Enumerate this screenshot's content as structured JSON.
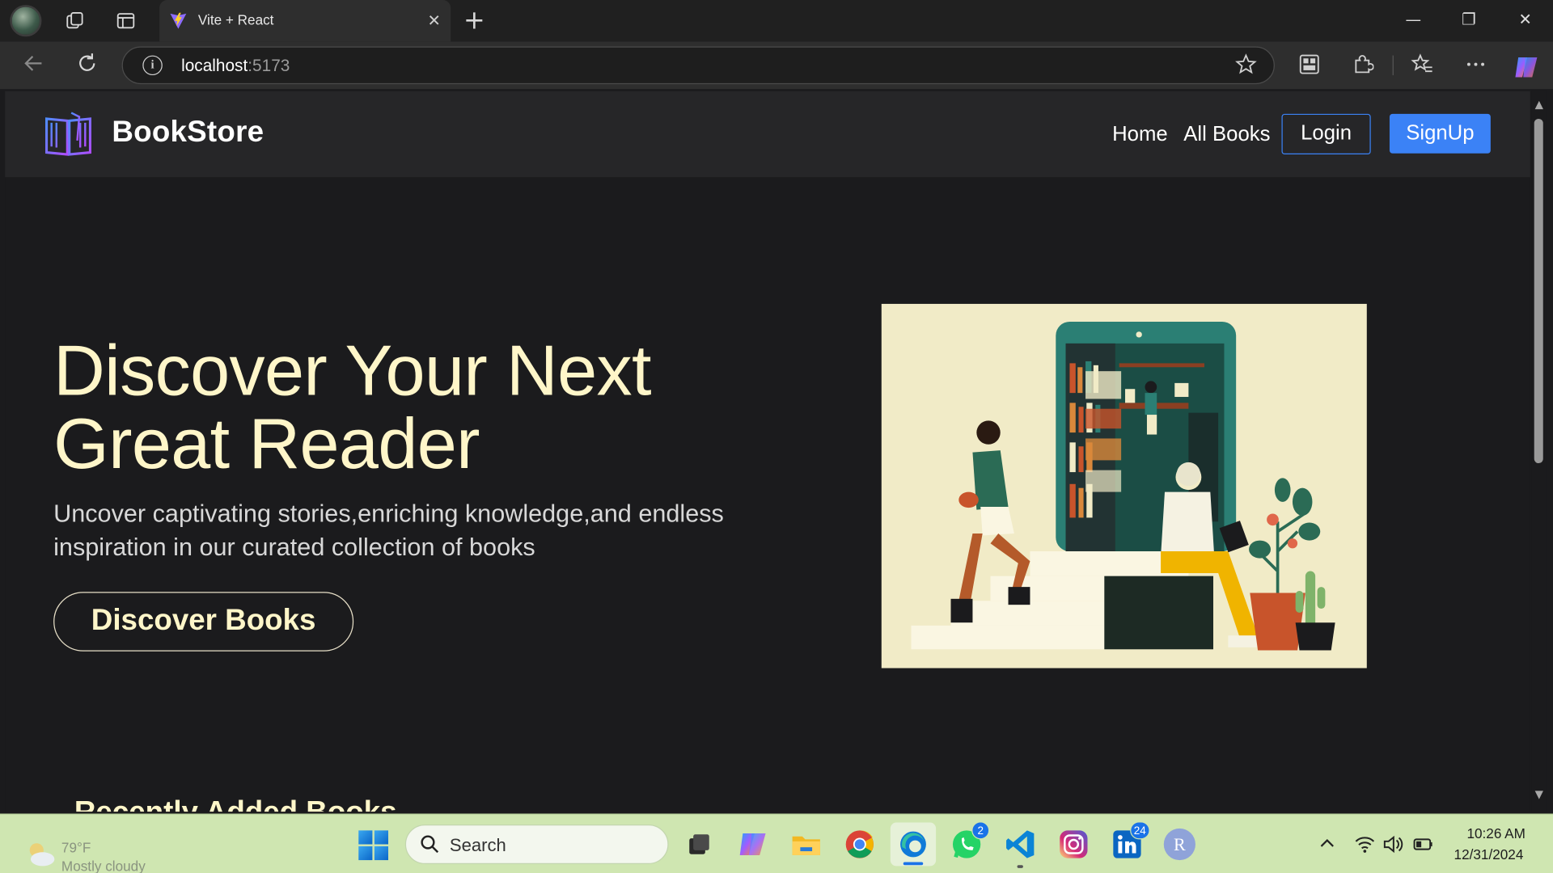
{
  "browser": {
    "tab": {
      "title": "Vite + React",
      "close": "✕"
    },
    "new_tab": "+",
    "address": {
      "host": "localhost",
      "port": ":5173"
    },
    "window_controls": {
      "minimize": "—",
      "restore": "❐",
      "close": "✕"
    },
    "icons": {
      "back": "arrow-left-icon",
      "refresh": "refresh-icon",
      "info": "info-icon",
      "favorite": "star-icon",
      "split_screen": "split-screen-icon",
      "extensions": "puzzle-icon",
      "favorites": "favorites-icon",
      "more": "ellipsis-icon",
      "copilot": "copilot-icon"
    }
  },
  "site": {
    "brand": "BookStore",
    "nav": {
      "home": "Home",
      "all_books": "All Books",
      "login": "Login",
      "signup": "SignUp"
    },
    "hero": {
      "title": "Discover Your Next Great Reader",
      "subtitle": "Uncover captivating stories,enriching knowledge,and endless inspiration in our curated collection of books",
      "cta": "Discover Books",
      "image": "reading-illustration"
    },
    "next_section_title": "Recently Added Books",
    "colors": {
      "accent": "#fff6c9",
      "primary": "#3b82f6",
      "nav_bg": "#262628",
      "page_bg": "#1b1b1d"
    }
  },
  "taskbar": {
    "weather": {
      "temp": "79°F",
      "desc": "Mostly cloudy"
    },
    "search_placeholder": "Search",
    "apps": [
      {
        "name": "task-view",
        "badge": ""
      },
      {
        "name": "copilot",
        "badge": ""
      },
      {
        "name": "file-explorer",
        "badge": ""
      },
      {
        "name": "chrome",
        "badge": ""
      },
      {
        "name": "edge",
        "badge": ""
      },
      {
        "name": "whatsapp",
        "badge": "2"
      },
      {
        "name": "vscode",
        "badge": ""
      },
      {
        "name": "instagram",
        "badge": ""
      },
      {
        "name": "linkedin",
        "badge": "24"
      },
      {
        "name": "profile",
        "badge": ""
      }
    ],
    "profile_letter": "R",
    "time": "10:26 AM",
    "date": "12/31/2024"
  }
}
